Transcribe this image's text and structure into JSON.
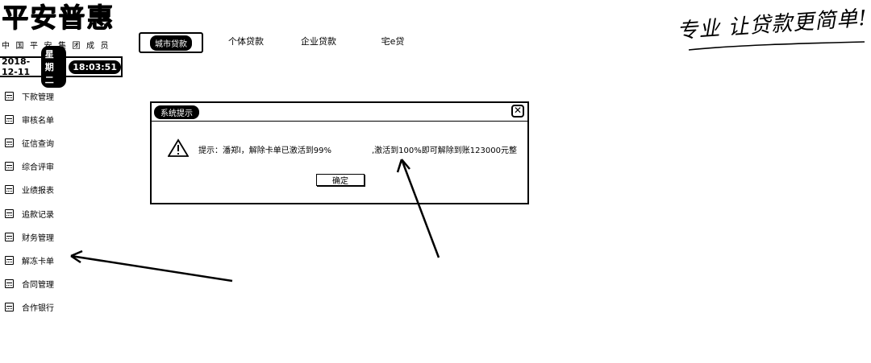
{
  "logo": {
    "brand": "平安普惠",
    "tagline": "中国平安集团成员"
  },
  "slogan": "专业 让贷款更简单!",
  "nav": {
    "items": [
      "城市贷款",
      "个体贷款",
      "企业贷款",
      "宅e贷"
    ]
  },
  "datebar": {
    "date": "2018-12-11",
    "weekday": "星期二",
    "time": "18:03:51"
  },
  "sidebar": {
    "items": [
      "下款管理",
      "审核名单",
      "征信查询",
      "综合评审",
      "业绩报表",
      "追款记录",
      "财务管理",
      "解冻卡单",
      "合同管理",
      "合作银行"
    ]
  },
  "dialog": {
    "title": "系统提示",
    "close": "✕",
    "message_left": "提示：潘郑l，解除卡单已激活到99%",
    "message_right": ",激活到100%即可解除到账123000元整",
    "ok": "确定"
  },
  "icons": {
    "warning": "warning-icon",
    "close": "close-icon",
    "sidebar": "calendar-icon"
  }
}
